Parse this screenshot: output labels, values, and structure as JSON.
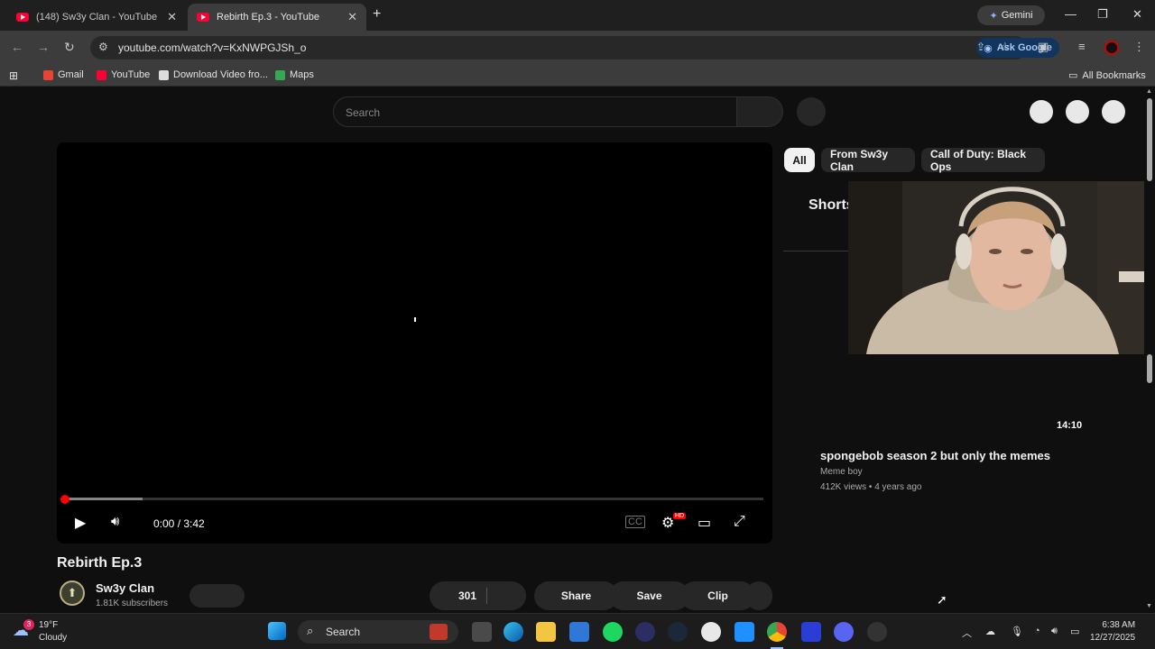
{
  "browser": {
    "tabs": [
      {
        "label": "(148) Sw3y Clan - YouTube"
      },
      {
        "label": "Rebirth Ep.3 - YouTube"
      }
    ],
    "gemini_label": "Gemini",
    "url": "youtube.com/watch?v=KxNWPGJSh_o",
    "ask_google_label": "Ask Google",
    "bookmarks": [
      {
        "label": "Gmail"
      },
      {
        "label": "YouTube"
      },
      {
        "label": "Download Video fro..."
      },
      {
        "label": "Maps"
      }
    ],
    "all_bookmarks_label": "All Bookmarks"
  },
  "youtube": {
    "search_placeholder": "Search",
    "player": {
      "current_time": "0:00",
      "time_sep": " / ",
      "duration": "3:42",
      "buffered_fraction": 0.11,
      "settings_badge": "HD"
    },
    "video_title": "Rebirth Ep.3",
    "channel": {
      "name": "Sw3y Clan",
      "subscribers": "1.81K subscribers"
    },
    "actions": {
      "likes": "301",
      "share_label": "Share",
      "save_label": "Save",
      "clip_label": "Clip"
    },
    "filter_chips": [
      {
        "label": "All",
        "active": true
      },
      {
        "label": "From Sw3y Clan",
        "active": false
      },
      {
        "label": "Call of Duty: Black Ops",
        "active": false
      }
    ],
    "shorts_label": "Shorts",
    "recommendation": {
      "duration": "14:10",
      "title": "spongebob season 2 but only the memes",
      "channel": "Meme boy",
      "views": "412K views",
      "meta_sep": " • ",
      "age": "4 years ago"
    }
  },
  "taskbar": {
    "weather_temp": "19°F",
    "weather_desc": "Cloudy",
    "weather_badge": "3",
    "search_label": "Search",
    "time": "6:38 AM",
    "date": "12/27/2025"
  },
  "colors": {
    "youtube_red": "#ff0000",
    "background": "#0f0f0f",
    "ask_google_accent": "#a8c7fa"
  }
}
